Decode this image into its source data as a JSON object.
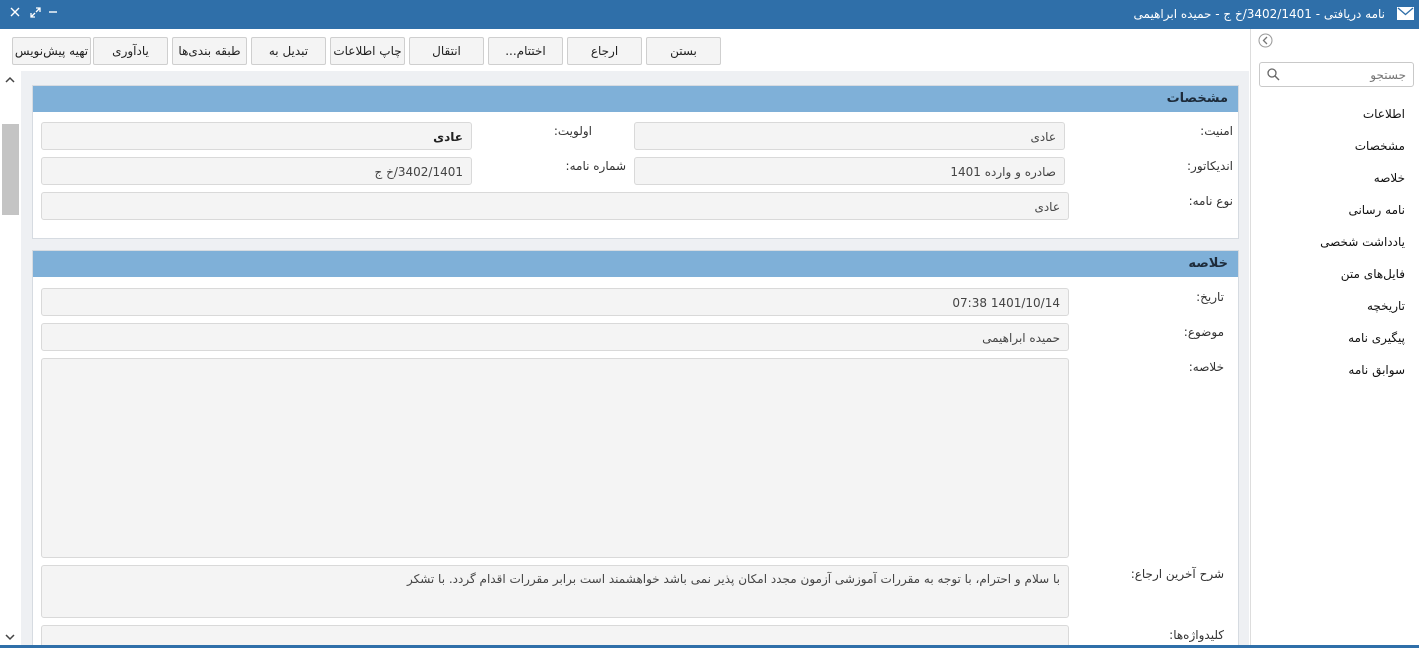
{
  "window": {
    "title": "نامه دریافتی - 3402/1401/خ ج - حمیده ابراهیمی",
    "controls": {
      "close": "×",
      "maximize": "⤢",
      "minimize": "−"
    }
  },
  "toolbar": {
    "buttons": [
      "تهیه پیش‌نویس",
      "یادآوری",
      "طبقه بندی‌ها",
      "تبدیل به",
      "چاپ اطلاعات",
      "انتقال",
      "اختتام...",
      "ارجاع",
      "بستن"
    ]
  },
  "sidebar": {
    "search_placeholder": "جستجو",
    "items": [
      "اطلاعات",
      "مشخصات",
      "خلاصه",
      "نامه رسانی",
      "یادداشت شخصی",
      "فایل‌های متن",
      "تاریخچه",
      "پیگیری نامه",
      "سوابق نامه"
    ]
  },
  "specs": {
    "header": "مشخصات",
    "security_label": "امنیت:",
    "security_value": "عادی",
    "priority_label": "اولویت:",
    "priority_value": "عادی",
    "indicator_label": "اندیکاتور:",
    "indicator_value": "صادره و وارده 1401",
    "letter_number_label": "شماره نامه:",
    "letter_number_value": "3402/1401/خ ج",
    "letter_type_label": "نوع نامه:",
    "letter_type_value": "عادی"
  },
  "summary": {
    "header": "خلاصه",
    "date_label": "تاریخ:",
    "date_value": "1401/10/14 07:38",
    "subject_label": "موضوع:",
    "subject_value": "حمیده ابراهیمی",
    "summary_label": "خلاصه:",
    "summary_value": "",
    "last_referral_label": "شرح آخرین ارجاع:",
    "last_referral_value": "با سلام و احترام، با توجه به مقررات آموزشی آزمون مجدد امکان پذیر نمی باشد خواهشمند است برابر مقررات اقدام گردد. با تشکر",
    "keywords_label": "کلیدواژه‌ها:"
  },
  "colors": {
    "titlebar": "#2f6fa9",
    "section_header": "#7fb0d8",
    "content_bg": "#eef0f3"
  },
  "icons": [
    "mail-icon",
    "close-icon",
    "maximize-icon",
    "minimize-icon",
    "collapse-icon",
    "search-icon",
    "chevron-up-icon",
    "chevron-down-icon"
  ]
}
